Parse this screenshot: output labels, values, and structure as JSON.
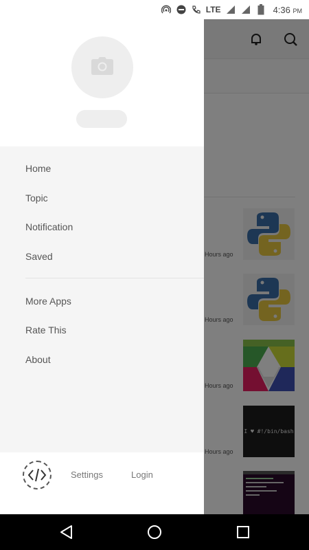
{
  "status_bar": {
    "network": "LTE",
    "time": "4:36",
    "ampm": "PM",
    "icons": [
      "hotspot-icon",
      "do-not-disturb-icon",
      "volte-call-icon",
      "signal-icon",
      "signal-icon",
      "battery-icon"
    ]
  },
  "app": {
    "feed": [
      {
        "time": "Hours ago",
        "thumb": "python-logo"
      },
      {
        "time": "Hours ago",
        "thumb": "python-logo"
      },
      {
        "time": "Hours ago",
        "thumb": "cube-logo"
      },
      {
        "time": "Hours ago",
        "thumb": "bash-text",
        "thumb_text": "I ♥ #!/bin/bash"
      },
      {
        "thumb": "terminal-screenshot"
      }
    ]
  },
  "drawer": {
    "menu": [
      {
        "label": "Home"
      },
      {
        "label": "Topic"
      },
      {
        "label": "Notification"
      },
      {
        "label": "Saved"
      },
      {
        "label": "More Apps"
      },
      {
        "label": "Rate This"
      },
      {
        "label": "About"
      }
    ],
    "footer": {
      "settings_label": "Settings",
      "login_label": "Login"
    }
  },
  "colors": {
    "drawer_bg": "#f5f5f5",
    "drawer_header_bg": "#ffffff",
    "menu_text": "#555555",
    "scrim": "rgba(0,0,0,0.5)"
  }
}
